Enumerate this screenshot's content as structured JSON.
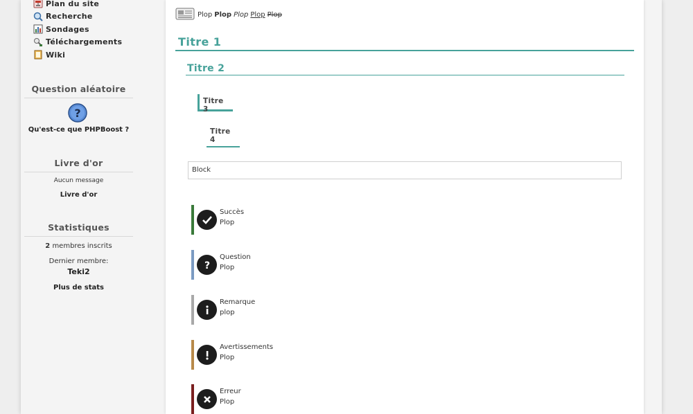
{
  "sidebar": {
    "menu": [
      {
        "label": "Plan du site",
        "icon": "sitemap-icon"
      },
      {
        "label": "Recherche",
        "icon": "search-icon"
      },
      {
        "label": "Sondages",
        "icon": "poll-icon"
      },
      {
        "label": "Téléchargements",
        "icon": "download-icon"
      },
      {
        "label": "Wiki",
        "icon": "book-icon"
      }
    ],
    "question": {
      "title": "Question aléatoire",
      "text": "Qu'est-ce que PHPBoost ?"
    },
    "guestbook": {
      "title": "Livre d'or",
      "empty": "Aucun message",
      "link": "Livre d'or"
    },
    "stats": {
      "title": "Statistiques",
      "members_count": "2",
      "members_label": "membres inscrits",
      "last_member_label": "Dernier membre:",
      "last_member": "Teki2",
      "more_link": "Plus de stats"
    }
  },
  "content": {
    "formatting": {
      "plain": "Plop",
      "bold": "Plop",
      "italic": "Plop",
      "underline": "Plop",
      "strike": "Plop"
    },
    "titre1": "Titre 1",
    "titre2": "Titre 2",
    "titre3": "Titre 3",
    "titre4": "Titre 4",
    "block": "Block",
    "messages": [
      {
        "title": "Succès",
        "body": "Plop",
        "color": "#3a7a3a",
        "icon": "check-icon"
      },
      {
        "title": "Question",
        "body": "Plop",
        "color": "#7b9bc2",
        "icon": "question-icon"
      },
      {
        "title": "Remarque",
        "body": "plop",
        "color": "#a8a8a8",
        "icon": "info-icon"
      },
      {
        "title": "Avertissements",
        "body": "Plop",
        "color": "#b88a4a",
        "icon": "warning-icon"
      },
      {
        "title": "Erreur",
        "body": "Plop",
        "color": "#7a1f1f",
        "icon": "error-icon"
      }
    ]
  },
  "colors": {
    "accent": "#47a29a"
  }
}
